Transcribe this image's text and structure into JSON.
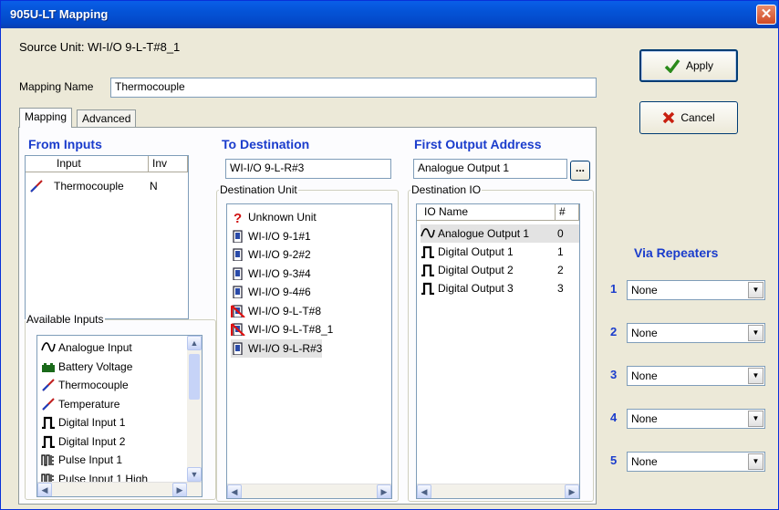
{
  "window": {
    "title": "905U-LT Mapping",
    "close_glyph": "✕"
  },
  "source_unit": "Source Unit: WI-I/O 9-L-T#8_1",
  "mapping_name": {
    "label": "Mapping Name",
    "value": "Thermocouple"
  },
  "buttons": {
    "apply": "Apply",
    "cancel": "Cancel",
    "browse": "..."
  },
  "tabs": [
    {
      "label": "Mapping",
      "active": true
    },
    {
      "label": "Advanced",
      "active": false
    }
  ],
  "from_inputs": {
    "heading": "From Inputs",
    "columns": [
      "Input",
      "Inv"
    ],
    "rows": [
      {
        "icon": "thermocouple-icon",
        "input": "Thermocouple",
        "inv": "N"
      }
    ]
  },
  "available_inputs": {
    "label": "Available Inputs",
    "items": [
      {
        "icon": "analogue-icon",
        "label": "Analogue Input"
      },
      {
        "icon": "battery-icon",
        "label": "Battery Voltage"
      },
      {
        "icon": "thermocouple-icon",
        "label": "Thermocouple"
      },
      {
        "icon": "thermocouple-icon",
        "label": "Temperature"
      },
      {
        "icon": "digital-icon",
        "label": "Digital Input 1"
      },
      {
        "icon": "digital-icon",
        "label": "Digital Input 2"
      },
      {
        "icon": "pulse-icon",
        "label": "Pulse Input 1"
      },
      {
        "icon": "pulse-icon",
        "label": "Pulse Input 1 High"
      }
    ]
  },
  "to_destination": {
    "heading": "To Destination",
    "value": "WI-I/O 9-L-R#3",
    "group_label": "Destination Unit",
    "units": [
      {
        "icon": "unknown-icon",
        "label": "Unknown Unit",
        "selected": false
      },
      {
        "icon": "unit-icon",
        "label": "WI-I/O 9-1#1",
        "selected": false
      },
      {
        "icon": "unit-icon",
        "label": "WI-I/O 9-2#2",
        "selected": false
      },
      {
        "icon": "unit-icon",
        "label": "WI-I/O 9-3#4",
        "selected": false
      },
      {
        "icon": "unit-icon",
        "label": "WI-I/O 9-4#6",
        "selected": false
      },
      {
        "icon": "unit-disabled-icon",
        "label": "WI-I/O 9-L-T#8",
        "selected": false
      },
      {
        "icon": "unit-disabled-icon",
        "label": "WI-I/O 9-L-T#8_1",
        "selected": false
      },
      {
        "icon": "unit-icon",
        "label": "WI-I/O 9-L-R#3",
        "selected": true
      }
    ]
  },
  "first_output": {
    "heading": "First Output Address",
    "value": "Analogue Output 1",
    "group_label": "Destination IO",
    "columns": [
      "IO Name",
      "#"
    ],
    "rows": [
      {
        "icon": "analogue-icon",
        "name": "Analogue Output 1",
        "num": "0",
        "selected": true
      },
      {
        "icon": "digital-icon",
        "name": "Digital Output 1",
        "num": "1",
        "selected": false
      },
      {
        "icon": "digital-icon",
        "name": "Digital Output 2",
        "num": "2",
        "selected": false
      },
      {
        "icon": "digital-icon",
        "name": "Digital Output 3",
        "num": "3",
        "selected": false
      }
    ]
  },
  "via_repeaters": {
    "heading": "Via Repeaters",
    "items": [
      {
        "num": "1",
        "value": "None"
      },
      {
        "num": "2",
        "value": "None"
      },
      {
        "num": "3",
        "value": "None"
      },
      {
        "num": "4",
        "value": "None"
      },
      {
        "num": "5",
        "value": "None"
      }
    ]
  },
  "colors": {
    "heading": "#1a3ccc",
    "title_bar": "#0453d6",
    "window_bg": "#ece9d8"
  }
}
